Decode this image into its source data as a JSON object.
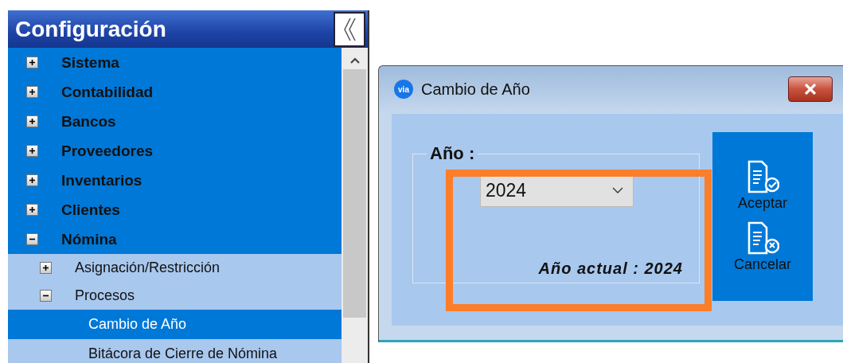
{
  "sidebar": {
    "title": "Configuración",
    "items": [
      {
        "label": "Sistema",
        "expanded": false,
        "selected": false
      },
      {
        "label": "Contabilidad",
        "expanded": false,
        "selected": false
      },
      {
        "label": "Bancos",
        "expanded": false,
        "selected": false
      },
      {
        "label": "Proveedores",
        "expanded": false,
        "selected": false
      },
      {
        "label": "Inventarios",
        "expanded": false,
        "selected": false
      },
      {
        "label": "Clientes",
        "expanded": false,
        "selected": false
      },
      {
        "label": "Nómina",
        "expanded": true,
        "selected": false,
        "children": [
          {
            "label": "Asignación/Restricción",
            "expanded": false,
            "selected": false
          },
          {
            "label": "Procesos",
            "expanded": true,
            "selected": false,
            "children": [
              {
                "label": "Cambio de Año",
                "selected": true
              },
              {
                "label": "Bitácora de Cierre de Nómina",
                "selected": false
              }
            ]
          }
        ]
      }
    ]
  },
  "dialog": {
    "title": "Cambio de Año",
    "logo": "via",
    "group_label": "Año :",
    "year_select": {
      "value": "2024"
    },
    "current_year": "Año actual : 2024",
    "buttons": [
      {
        "label": "Aceptar",
        "kind": "accept"
      },
      {
        "label": "Cancelar",
        "kind": "cancel"
      }
    ],
    "annotation": {
      "kind": "highlight"
    }
  }
}
